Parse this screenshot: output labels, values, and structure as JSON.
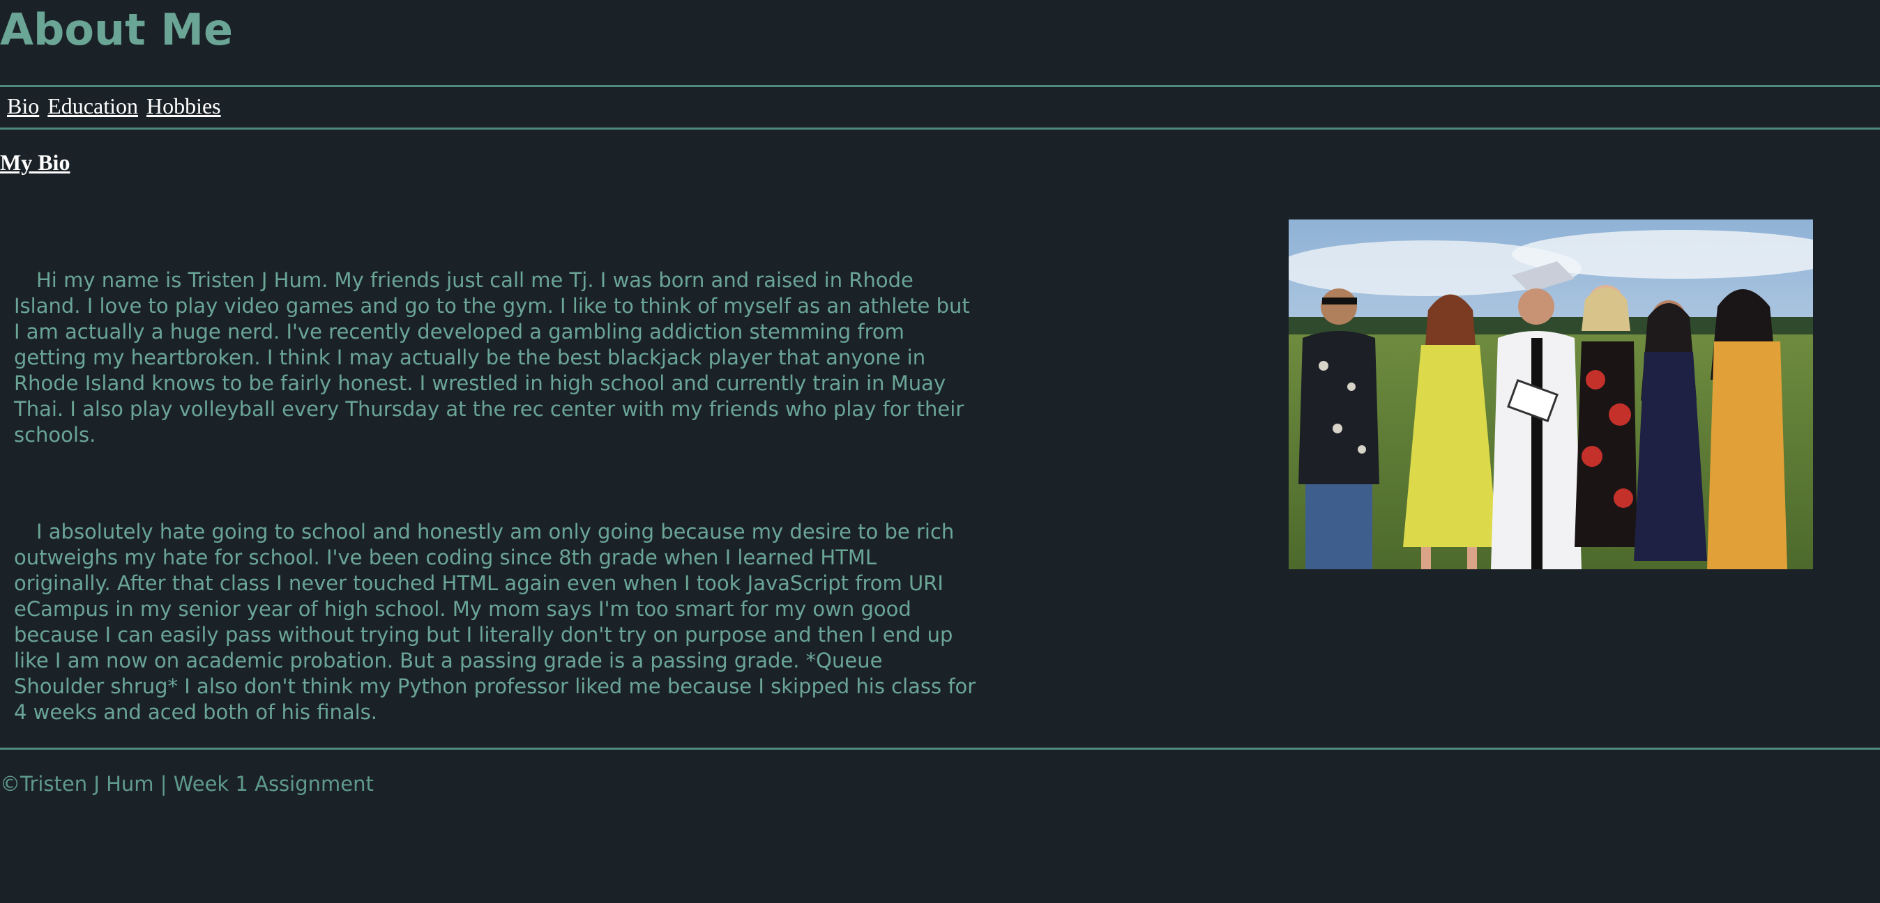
{
  "header": {
    "title": "About Me"
  },
  "nav": {
    "links": [
      "Bio",
      "Education",
      "Hobbies"
    ]
  },
  "main": {
    "heading": "My Bio",
    "paragraphs": [
      "Hi my name is Tristen J Hum. My friends just call me Tj. I was born and raised in Rhode Island. I love to play video games and go to the gym. I like to think of myself as an athlete but I am actually a huge nerd. I've recently developed a gambling addiction stemming from getting my heartbroken. I think I may actually be the best blackjack player that anyone in Rhode Island knows to be fairly honest. I wrestled in high school and currently train in Muay Thai. I also play volleyball every Thursday at the rec center with my friends who play for their schools.",
      "I absolutely hate going to school and honestly am only going because my desire to be rich outweighs my hate for school. I've been coding since 8th grade when I learned HTML originally. After that class I never touched HTML again even when I took JavaScript from URI eCampus in my senior year of high school. My mom says I'm too smart for my own good because I can easily pass without trying but I literally don't try on purpose and then I end up like I am now on academic probation. But a passing grade is a passing grade. *Queue Shoulder shrug* I also don't think my Python professor liked me because I skipped his class for 4 weeks and aced both of his finals."
    ]
  },
  "footer": {
    "text": "©Tristen J Hum | Week 1 Assignment"
  },
  "colors": {
    "background": "#1b2227",
    "accent": "#6aa596",
    "rule": "#4e8a7d",
    "link": "#ffffff"
  }
}
